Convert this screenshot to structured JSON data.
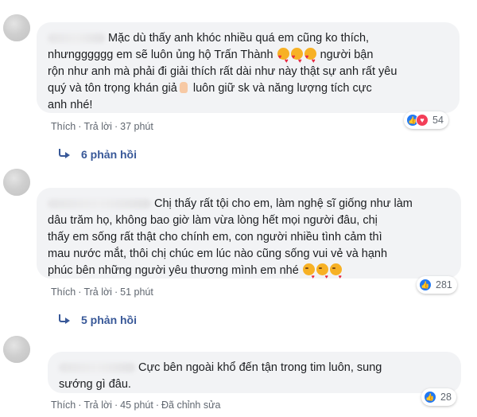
{
  "comments": [
    {
      "text_1": "Mặc dù thấy anh khóc nhiều quá em cũng ko thích,",
      "text_2": "nhưngggggg em sẽ luôn ủng hộ Trấn Thành",
      "text_3": " người bận",
      "text_4": "rộn như anh mà phải đi giải thích rất dài như này thật sự anh rất yêu",
      "text_5": "quý và tôn trọng khán giả",
      "text_6": " luôn giữ sk và năng lượng tích cực",
      "text_7": "anh nhé!",
      "emoji_1": "smiling-face-with-hearts",
      "emoji_2": "thumbs-up",
      "like": "Thích",
      "reply": "Trả lời",
      "time": "37 phút",
      "reaction_count": "54",
      "replies_label": "6 phản hồi"
    },
    {
      "text_1": "Chị thấy rất tội cho em, làm nghệ sĩ giống như làm",
      "text_2": "dâu trăm họ, không bao giờ làm vừa lòng hết mọi người đâu, chị",
      "text_3": "thấy em sống rất thật cho chính em, con người nhiều tình cảm thì",
      "text_4": "mau nước mắt, thôi chị chúc em lúc nào cũng sống vui vẻ và hạnh",
      "text_5": "phúc bên những người yêu thương mình em nhé",
      "emoji_1": "face-blowing-a-kiss",
      "like": "Thích",
      "reply": "Trả lời",
      "time": "51 phút",
      "reaction_count": "281",
      "replies_label": "5 phản hồi"
    },
    {
      "text_1": "Cực bên ngoài khổ đến tận trong tim luôn, sung",
      "text_2": "sướng gì đâu.",
      "like": "Thích",
      "reply": "Trả lời",
      "time": "45 phút",
      "edited": "Đã chỉnh sửa",
      "reaction_count": "28"
    }
  ],
  "colors": {
    "bubble_bg": "#f2f3f5",
    "link_blue": "#385898",
    "meta_gray": "#606770",
    "like_blue": "#2078f4",
    "love_red": "#f33e58"
  }
}
